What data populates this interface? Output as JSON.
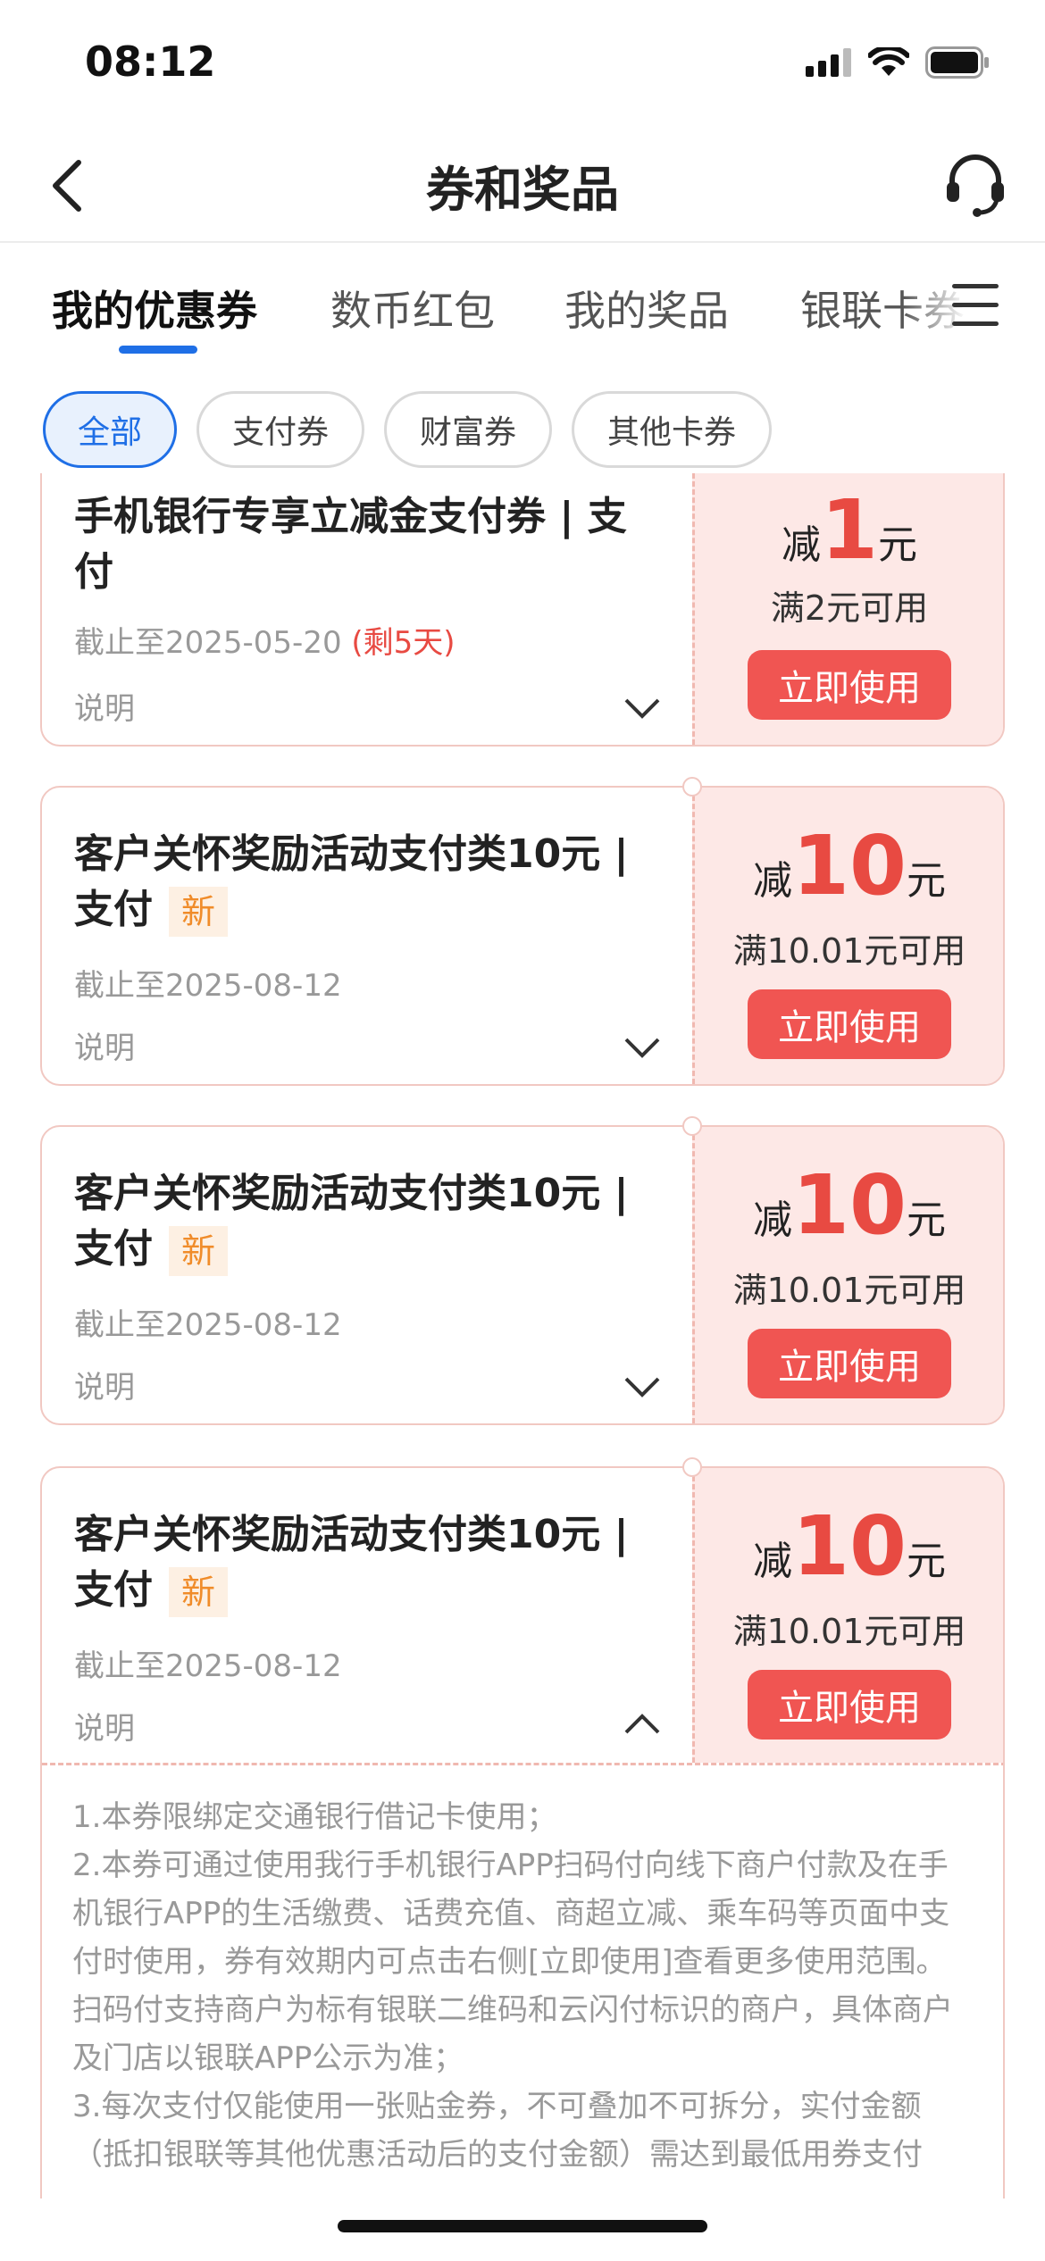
{
  "status_bar": {
    "time": "08:12"
  },
  "header": {
    "title": "券和奖品"
  },
  "tabs": [
    "我的优惠券",
    "数币红包",
    "我的奖品",
    "银联卡券"
  ],
  "filters": [
    "全部",
    "支付券",
    "财富券",
    "其他卡券"
  ],
  "coupons": [
    {
      "name": "手机银行专享立减金支付券 | 支付",
      "expiry": "截止至2025-05-20",
      "remain": "(剩5天)",
      "explain": "说明",
      "prefix": "减",
      "amount": "1",
      "unit": "元",
      "condition": "满2元可用",
      "button": "立即使用"
    },
    {
      "name": "客户关怀奖励活动支付类10元 | 支付",
      "badge": "新",
      "expiry": "截止至2025-08-12",
      "explain": "说明",
      "prefix": "减",
      "amount": "10",
      "unit": "元",
      "condition": "满10.01元可用",
      "button": "立即使用"
    },
    {
      "name": "客户关怀奖励活动支付类10元 | 支付",
      "badge": "新",
      "expiry": "截止至2025-08-12",
      "explain": "说明",
      "prefix": "减",
      "amount": "10",
      "unit": "元",
      "condition": "满10.01元可用",
      "button": "立即使用"
    },
    {
      "name": "客户关怀奖励活动支付类10元 | 支付",
      "badge": "新",
      "expiry": "截止至2025-08-12",
      "explain": "说明",
      "prefix": "减",
      "amount": "10",
      "unit": "元",
      "condition": "满10.01元可用",
      "button": "立即使用"
    }
  ],
  "details": [
    "1.本券限绑定交通银行借记卡使用；",
    "2.本券可通过使用我行手机银行APP扫码付向线下商户付款及在手机银行APP的生活缴费、话费充值、商超立减、乘车码等页面中支付时使用，券有效期内可点击右侧[立即使用]查看更多使用范围。扫码付支持商户为标有银联二维码和云闪付标识的商户，具体商户及门店以银联APP公示为准；",
    "3.每次支付仅能使用一张贴金券，不可叠加不可拆分，实付金额（抵扣银联等其他优惠活动后的支付金额）需达到最低用券支付"
  ],
  "colors": {
    "accent": "#1f6fe6",
    "coupon_red": "#e84a42",
    "coupon_bg": "#fde8e6",
    "badge_orange": "#f08c2a"
  }
}
